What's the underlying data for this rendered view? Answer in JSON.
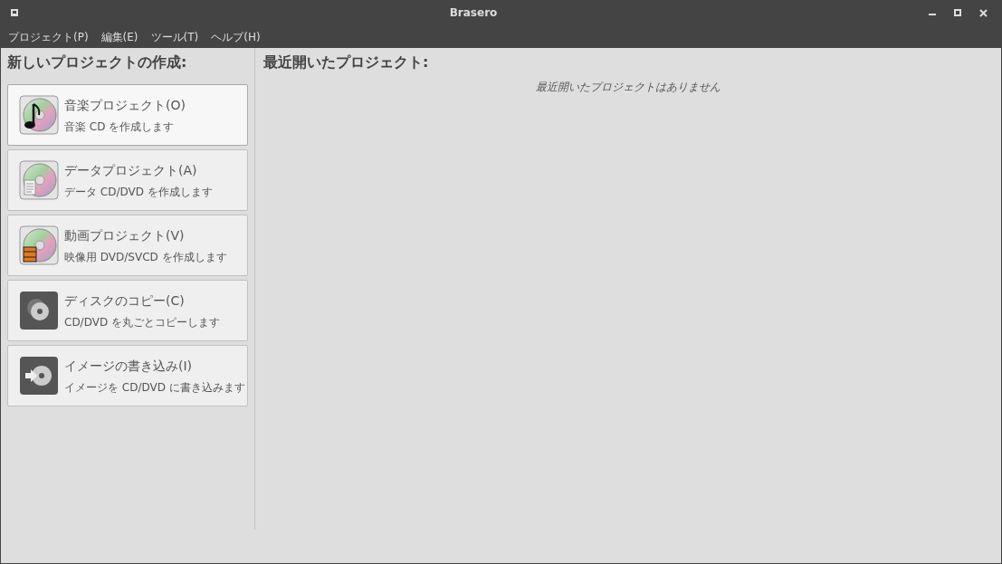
{
  "window": {
    "title": "Brasero"
  },
  "menu": [
    "プロジェクト(P)",
    "編集(E)",
    "ツール(T)",
    "ヘルプ(H)"
  ],
  "new_project": {
    "heading": "新しいプロジェクトの作成:",
    "items": [
      {
        "kind": "music",
        "title": "音楽プロジェクト(O)",
        "description": "音楽 CD を作成します",
        "selected": true
      },
      {
        "kind": "data",
        "title": "データプロジェクト(A)",
        "description": "データ CD/DVD を作成します",
        "selected": false
      },
      {
        "kind": "video",
        "title": "動画プロジェクト(V)",
        "description": "映像用 DVD/SVCD を作成します",
        "selected": false
      },
      {
        "kind": "copy",
        "title": "ディスクのコピー(C)",
        "description": "CD/DVD を丸ごとコピーします",
        "selected": false
      },
      {
        "kind": "burn",
        "title": "イメージの書き込み(I)",
        "description": "イメージを CD/DVD に書き込みます",
        "selected": false
      }
    ]
  },
  "recent": {
    "heading": "最近開いたプロジェクト:",
    "empty_message": "最近開いたプロジェクトはありません"
  }
}
